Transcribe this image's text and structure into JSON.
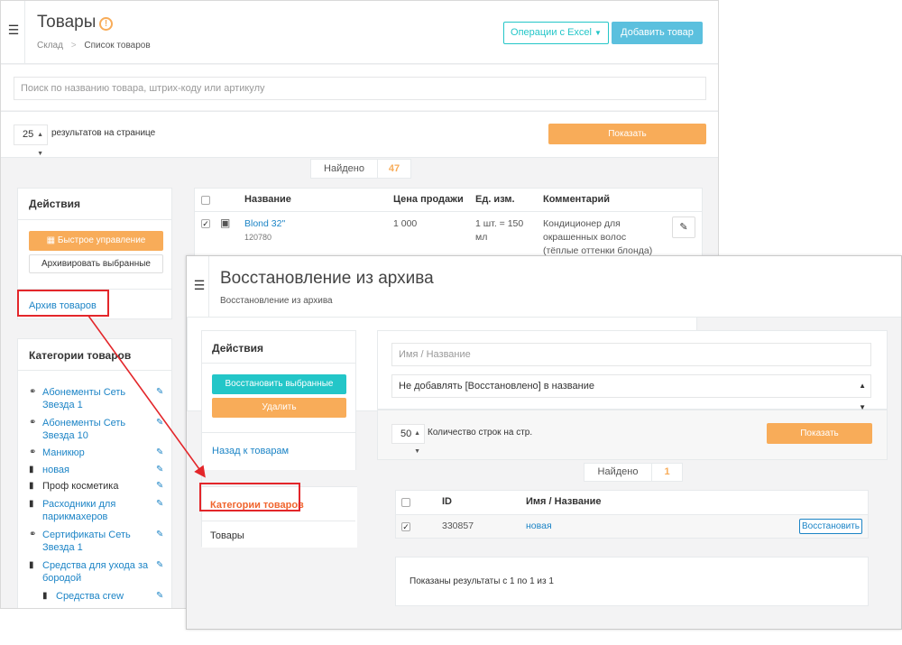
{
  "colors": {
    "accent_orange": "#f8ac59",
    "teal": "#23c6c8",
    "info_blue": "#5bc0de",
    "link_blue": "#1c84c6",
    "annotation_red": "#e3262a"
  },
  "back_window": {
    "title": "Товары",
    "breadcrumb": {
      "root": "Склад",
      "separator": ">",
      "current": "Список товаров"
    },
    "excel_button": "Операции с Excel",
    "add_button": "Добавить товар",
    "search_placeholder": "Поиск по названию товара, штрих-коду или артикулу",
    "per_page_value": "25",
    "per_page_label": "результатов на странице",
    "show_button": "Показать",
    "found_label": "Найдено",
    "found_count": "47",
    "actions": {
      "title": "Действия",
      "quick_manage": "Быстрое управление",
      "archive_selected": "Архивировать выбранные",
      "archive_link": "Архив товаров"
    },
    "categories": {
      "title": "Категории товаров",
      "items": [
        {
          "icon": "link-icon",
          "line1": "Абонементы Сеть",
          "line2": "Звезда 1"
        },
        {
          "icon": "link-icon",
          "line1": "Абонементы Сеть",
          "line2": "Звезда 10"
        },
        {
          "icon": "link-icon",
          "line1": "Маникюр",
          "line2": ""
        },
        {
          "icon": "folder-icon",
          "line1": "новая",
          "line2": ""
        },
        {
          "icon": "folder-icon",
          "line1": "Проф косметика",
          "line2": ""
        },
        {
          "icon": "folder-icon",
          "line1": "Расходники для",
          "line2": "парикмахеров"
        },
        {
          "icon": "link-icon",
          "line1": "Сертификаты Сеть",
          "line2": "Звезда 1"
        },
        {
          "icon": "folder-icon",
          "line1": "Средства для ухода за",
          "line2": "бородой"
        },
        {
          "icon": "folder-icon",
          "line1": "Средства crew",
          "line2": ""
        }
      ]
    },
    "table": {
      "headers": {
        "name": "Название",
        "price": "Цена продажи",
        "unit": "Ед. изм.",
        "comment": "Комментарий"
      },
      "row": {
        "name": "Blond 32\"",
        "code": "120780",
        "price": "1 000",
        "unit_line1": "1 шт. = 150",
        "unit_line2": "мл",
        "comment_line1": "Кондиционер для",
        "comment_line2": "окрашенных волос",
        "comment_line3": "(тёплые оттенки блонда)"
      }
    }
  },
  "front_window": {
    "title": "Восстановление из архива",
    "subtitle": "Восстановление из архива",
    "actions": {
      "title": "Действия",
      "restore_selected": "Восстановить выбранные",
      "delete": "Удалить",
      "back_link": "Назад к товарам",
      "categories_link": "Категории товаров",
      "goods": "Товары"
    },
    "name_placeholder": "Имя / Название",
    "select_value": "Не добавлять [Восстановлено] в название",
    "per_page_value": "50",
    "per_page_label": "Количество строк на стр.",
    "show_button": "Показать",
    "found_label": "Найдено",
    "found_count": "1",
    "table": {
      "headers": {
        "id": "ID",
        "name": "Имя / Название"
      },
      "row": {
        "id": "330857",
        "name": "новая",
        "restore": "Восстановить"
      }
    },
    "summary": "Показаны результаты с 1 по 1 из 1"
  }
}
